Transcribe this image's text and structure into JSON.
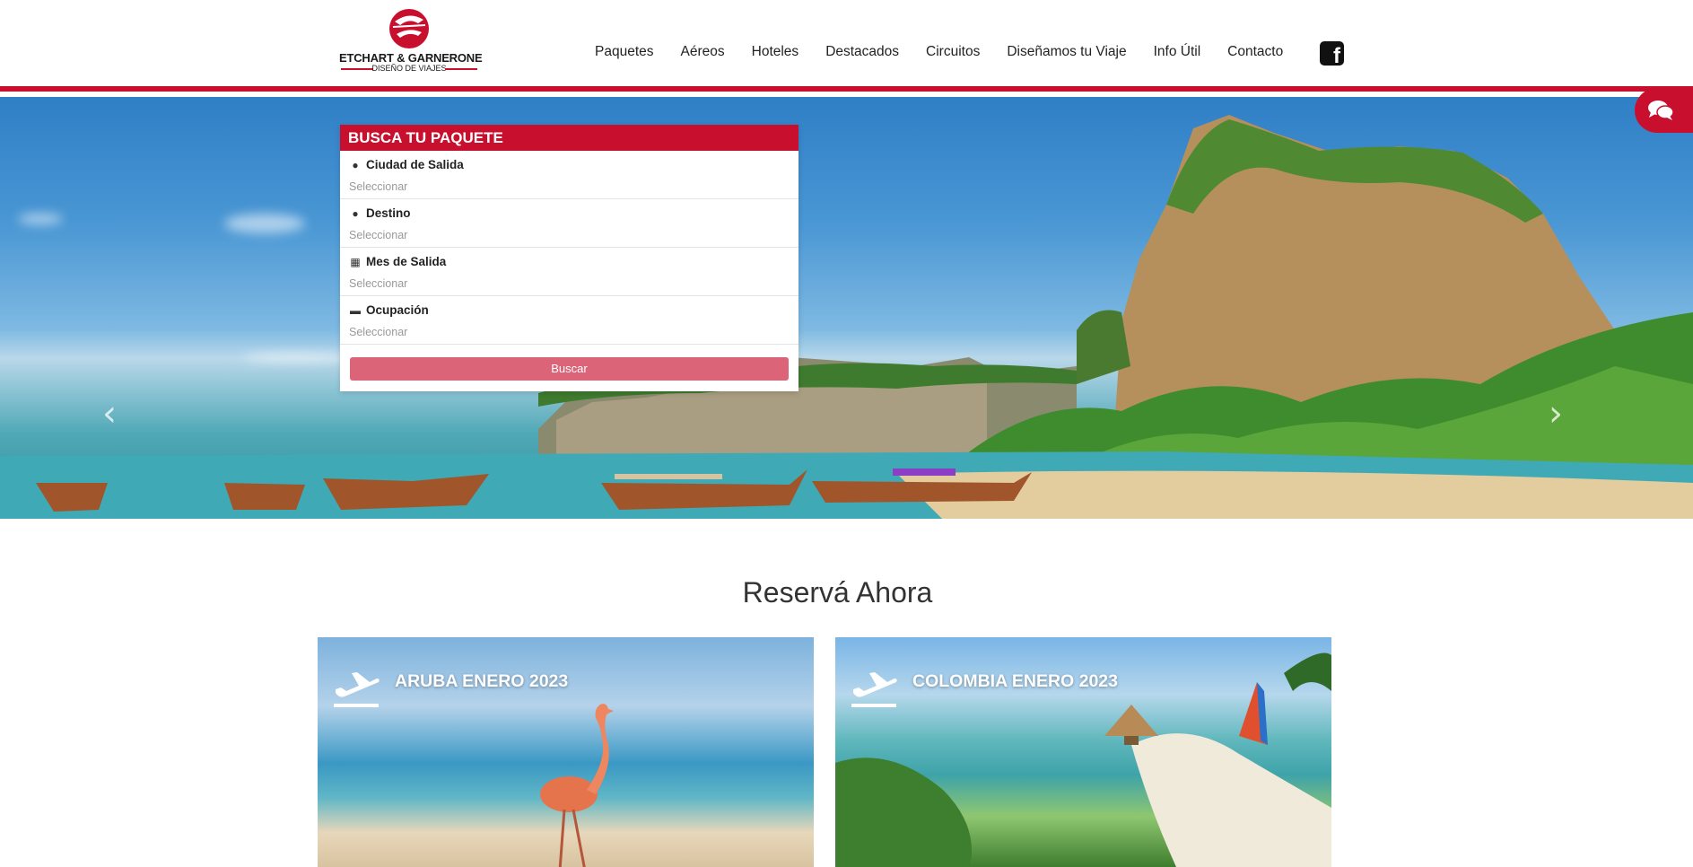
{
  "brand": {
    "name": "ETCHART & GARNERONE",
    "tagline": "DISEÑO DE VIAJES",
    "accent_color": "#c8102e"
  },
  "nav": {
    "items": [
      "Paquetes",
      "Aéreos",
      "Hoteles",
      "Destacados",
      "Circuitos",
      "Diseñamos tu Viaje",
      "Info Útil",
      "Contacto"
    ],
    "social_icon": "facebook-icon"
  },
  "hero": {
    "prev_icon": "chevron-left-icon",
    "next_icon": "chevron-right-icon",
    "slides": 2,
    "active_slide": 1
  },
  "chat": {
    "icon": "chat-bubbles-icon"
  },
  "search": {
    "title": "BUSCA TU PAQUETE",
    "fields": [
      {
        "label": "Ciudad de Salida",
        "placeholder": "Seleccionar",
        "icon": "map-marker-icon"
      },
      {
        "label": "Destino",
        "placeholder": "Seleccionar",
        "icon": "map-marker-icon"
      },
      {
        "label": "Mes de Salida",
        "placeholder": "Seleccionar",
        "icon": "calendar-icon"
      },
      {
        "label": "Ocupación",
        "placeholder": "Seleccionar",
        "icon": "bed-icon"
      }
    ],
    "button_label": "Buscar",
    "button_color": "#dc6479"
  },
  "section": {
    "title": "Reservá Ahora"
  },
  "cards": [
    {
      "title": "ARUBA ENERO 2023",
      "icon": "airplane-departure-icon"
    },
    {
      "title": "COLOMBIA ENERO 2023",
      "icon": "airplane-departure-icon"
    }
  ]
}
